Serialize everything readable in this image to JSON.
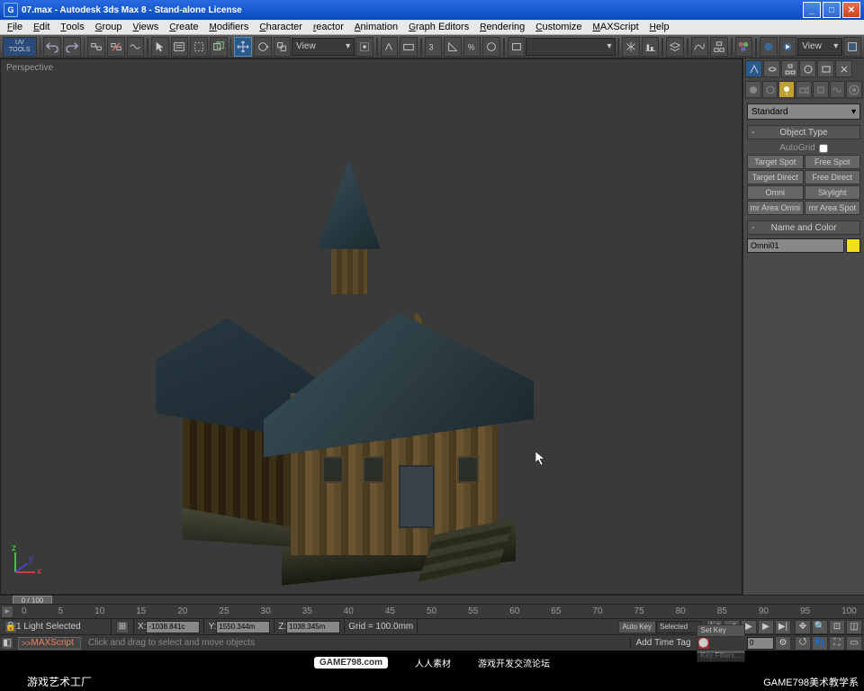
{
  "titlebar": {
    "app_icon": "G",
    "title": "07.max - Autodesk 3ds Max 8 - Stand-alone License"
  },
  "menu": [
    "File",
    "Edit",
    "Tools",
    "Group",
    "Views",
    "Create",
    "Modifiers",
    "Character",
    "reactor",
    "Animation",
    "Graph Editors",
    "Rendering",
    "Customize",
    "MAXScript",
    "Help"
  ],
  "toolbar": {
    "uv_tools": "UV\nTOOLS",
    "view_dd": "View",
    "view_dd2": "View"
  },
  "viewport": {
    "label": "Perspective"
  },
  "cmd": {
    "category": "Standard",
    "rollout1": "Object Type",
    "autogrid": "AutoGrid",
    "buttons": [
      "Target Spot",
      "Free Spot",
      "Target Direct",
      "Free Direct",
      "Omni",
      "Skylight",
      "mr Area Omni",
      "mr Area Spot"
    ],
    "rollout2": "Name and Color",
    "obj_name": "Omni01"
  },
  "scrubber": {
    "frame": "0 / 100"
  },
  "timeline": {
    "ticks": [
      "0",
      "5",
      "10",
      "15",
      "20",
      "25",
      "30",
      "35",
      "40",
      "45",
      "50",
      "55",
      "60",
      "65",
      "70",
      "75",
      "80",
      "85",
      "90",
      "95",
      "100"
    ]
  },
  "status": {
    "sel": "1 Light Selected",
    "x": "-1038.841c",
    "y": "1550.344m",
    "z": "1038.345m",
    "grid": "Grid = 100.0mm",
    "autokey": "Auto Key",
    "selected_dd": "Selected",
    "setkey": "Set Key",
    "keyfilters": "Key Filters..."
  },
  "status2": {
    "script": "MAXScript",
    "prompt": "Click and drag to select and move objects",
    "timetag": "Add Time Tag"
  },
  "watermark": {
    "logo": "GAME798.com",
    "center": "人人素材",
    "right": "游戏开发交流论坛",
    "bl": "游戏艺术工厂",
    "br": "GAME798美术教学系"
  }
}
